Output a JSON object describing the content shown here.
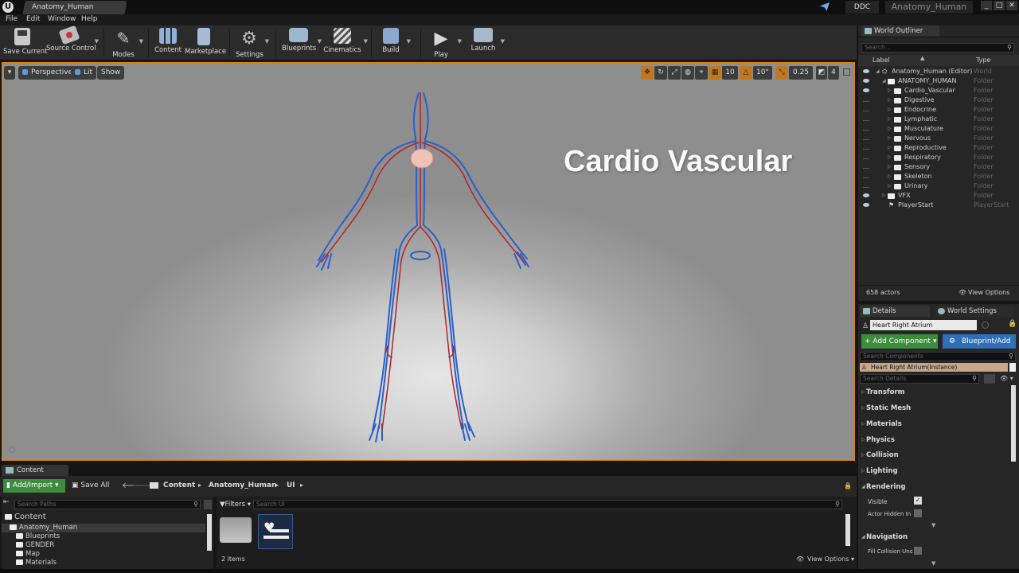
{
  "titlebar": {
    "logo": "U",
    "doc_tab": "Anatomy_Human",
    "ddc": "DDC",
    "project": "Anatomy_Human",
    "minimize": "_",
    "maximize": "□",
    "close": "✕"
  },
  "menu": [
    "File",
    "Edit",
    "Window",
    "Help"
  ],
  "toolbar": {
    "save_current": "Save Current",
    "source_control": "Source Control",
    "modes": "Modes",
    "content": "Content",
    "marketplace": "Marketplace",
    "settings": "Settings",
    "blueprints": "Blueprints",
    "cinematics": "Cinematics",
    "build": "Build",
    "play": "Play",
    "launch": "Launch"
  },
  "viewport": {
    "perspective": "Perspective",
    "lit": "Lit",
    "show": "Show",
    "grid_snap": "10",
    "rotation_snap": "10°",
    "scale_snap": "0.25",
    "camera_speed": "4",
    "overlay_title": "Cardio Vascular"
  },
  "outliner": {
    "tab": "World Outliner",
    "search_placeholder": "Search...",
    "col_label": "Label",
    "col_type": "Type",
    "rows": [
      {
        "name": "Anatomy_Human (Editor)",
        "type": "World"
      },
      {
        "name": "ANATOMY_HUMAN",
        "type": "Folder"
      },
      {
        "name": "Cardio_Vascular",
        "type": "Folder"
      },
      {
        "name": "Digestive",
        "type": "Folder"
      },
      {
        "name": "Endocrine",
        "type": "Folder"
      },
      {
        "name": "Lymphatic",
        "type": "Folder"
      },
      {
        "name": "Musculature",
        "type": "Folder"
      },
      {
        "name": "Nervous",
        "type": "Folder"
      },
      {
        "name": "Reproductive",
        "type": "Folder"
      },
      {
        "name": "Respiratory",
        "type": "Folder"
      },
      {
        "name": "Sensory",
        "type": "Folder"
      },
      {
        "name": "Skeleton",
        "type": "Folder"
      },
      {
        "name": "Urinary",
        "type": "Folder"
      },
      {
        "name": "VFX",
        "type": "Folder"
      },
      {
        "name": "PlayerStart",
        "type": "PlayerStart"
      }
    ],
    "actor_count": "658 actors",
    "view_options": "View Options"
  },
  "details": {
    "tab_details": "Details",
    "tab_world_settings": "World Settings",
    "selected_name": "Heart Right Atrium",
    "add_component": "+ Add Component",
    "blueprint_add": "Blueprint/Add",
    "search_components": "Search Components",
    "instance": "Heart Right Atrium(Instance)",
    "search_details": "Search Details",
    "sections": [
      "Transform",
      "Static Mesh",
      "Materials",
      "Physics",
      "Collision",
      "Lighting",
      "Rendering"
    ],
    "visible_label": "Visible",
    "actor_hidden_label": "Actor Hidden In G",
    "navigation": "Navigation",
    "fill_collision": "Fill Collision Und"
  },
  "content_browser": {
    "tab": "Content Browser",
    "add_import": "Add/Import",
    "save_all": "Save All",
    "breadcrumb": [
      "Content",
      "Anatomy_Human",
      "UI"
    ],
    "search_paths": "Search Paths",
    "filters": "Filters",
    "search_ui": "Search UI",
    "tree": [
      "Content",
      "Anatomy_Human",
      "Blueprints",
      "GENDER",
      "Map",
      "Materials"
    ],
    "item_count": "2 items",
    "view_options": "View Options"
  }
}
